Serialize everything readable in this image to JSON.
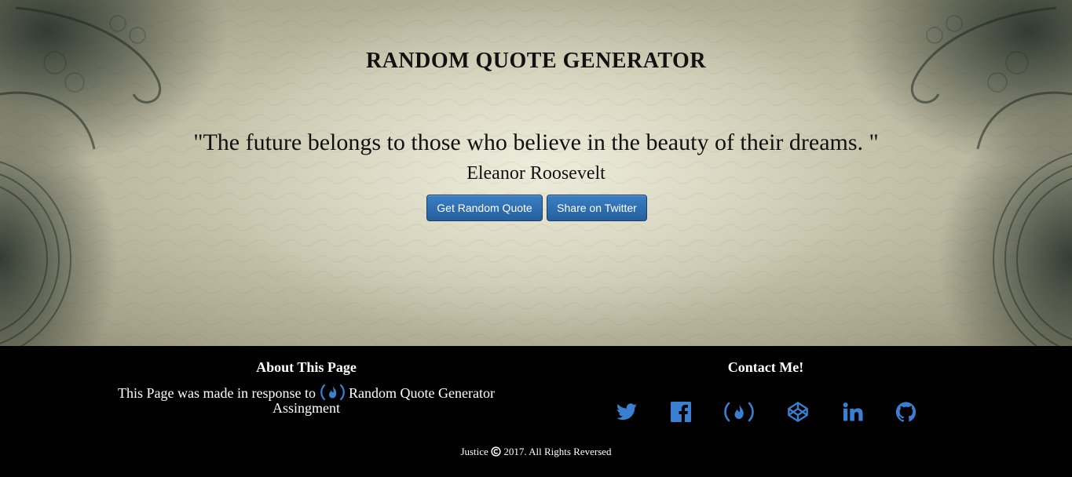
{
  "hero": {
    "title": "RANDOM QUOTE GENERATOR",
    "quote": "\"The future belongs to those who believe in the beauty of their dreams. \"",
    "author": "Eleanor Roosevelt",
    "buttons": {
      "random_quote": "Get Random Quote",
      "share_twitter": "Share on Twitter"
    }
  },
  "footer": {
    "about": {
      "heading": "About This Page",
      "text_before": "This Page was made in response to",
      "text_after": "Random Quote Generator Assingment"
    },
    "contact": {
      "heading": "Contact Me!",
      "icons": [
        "twitter-icon",
        "facebook-icon",
        "freecodecamp-icon",
        "codepen-icon",
        "linkedin-icon",
        "github-icon"
      ]
    },
    "copyright": {
      "name": "Justice",
      "text": "2017. All Rights Reversed"
    }
  },
  "colors": {
    "button_blue": "#2d6dae",
    "icon_blue": "#3b7fd1",
    "footer_bg": "#000000"
  }
}
